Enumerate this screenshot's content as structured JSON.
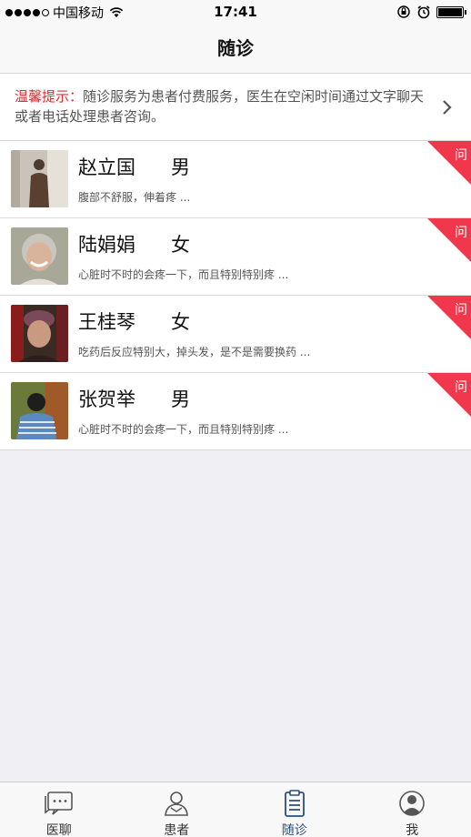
{
  "status_bar": {
    "carrier": "中国移动",
    "time": "17:41"
  },
  "nav": {
    "title": "随诊"
  },
  "tip": {
    "label": "温馨提示：",
    "text": "随诊服务为患者付费服务，医生在空闲时间通过文字聊天或者电话处理患者咨询。"
  },
  "patients": [
    {
      "name": "赵立国",
      "gender": "男",
      "desc": "腹部不舒服，伸着疼 ...",
      "badge": "问"
    },
    {
      "name": "陆娟娟",
      "gender": "女",
      "desc": "心脏时不时的会疼一下，而且特别特别疼 ...",
      "badge": "问"
    },
    {
      "name": "王桂琴",
      "gender": "女",
      "desc": "吃药后反应特别大，掉头发，是不是需要换药 ...",
      "badge": "问"
    },
    {
      "name": "张贺举",
      "gender": "男",
      "desc": "心脏时不时的会疼一下，而且特别特别疼 ...",
      "badge": "问"
    }
  ],
  "tabs": [
    {
      "label": "医聊",
      "icon": "chat-icon"
    },
    {
      "label": "患者",
      "icon": "person-icon"
    },
    {
      "label": "随诊",
      "icon": "clipboard-icon"
    },
    {
      "label": "我",
      "icon": "profile-icon"
    }
  ],
  "colors": {
    "accent_red": "#e52b2b",
    "ribbon_red": "#f0374b",
    "active_tab": "#2a4f7c"
  }
}
